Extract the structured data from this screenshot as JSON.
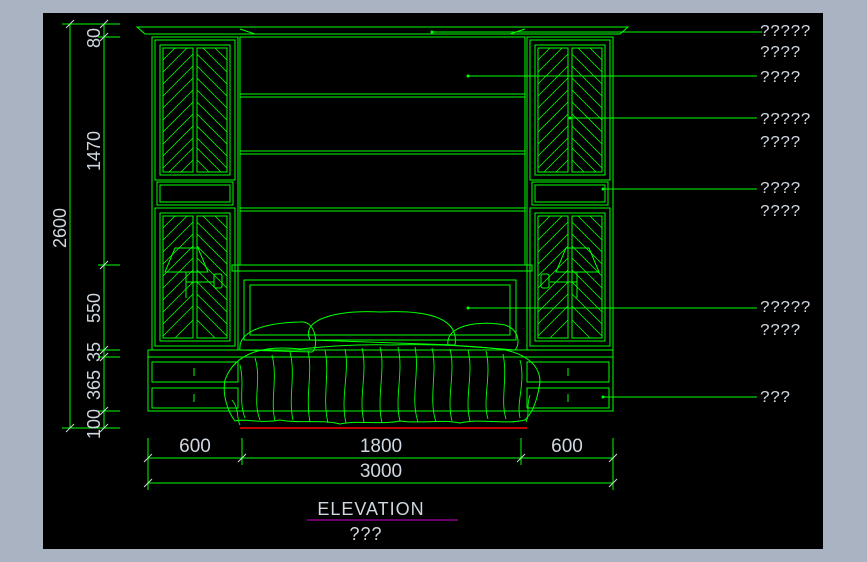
{
  "dimensions_vertical": {
    "total": "2600",
    "top_cap": "80",
    "upper": "1470",
    "middle": "550",
    "d35": "35",
    "d365": "365",
    "d100": "100"
  },
  "dimensions_horizontal": {
    "left": "600",
    "center": "1800",
    "right": "600",
    "total": "3000"
  },
  "leader_labels": [
    "?????",
    "????",
    "????",
    "?????",
    "????",
    "????",
    "????",
    "?????",
    "????",
    "???"
  ],
  "title": "ELEVATION",
  "subtitle": "???",
  "colors": {
    "line": "#00ff00",
    "text": "#cfd8e0",
    "floor": "#ff0000",
    "underline": "#d000d0",
    "background": "#000000",
    "frame": "#a9b3c2"
  }
}
